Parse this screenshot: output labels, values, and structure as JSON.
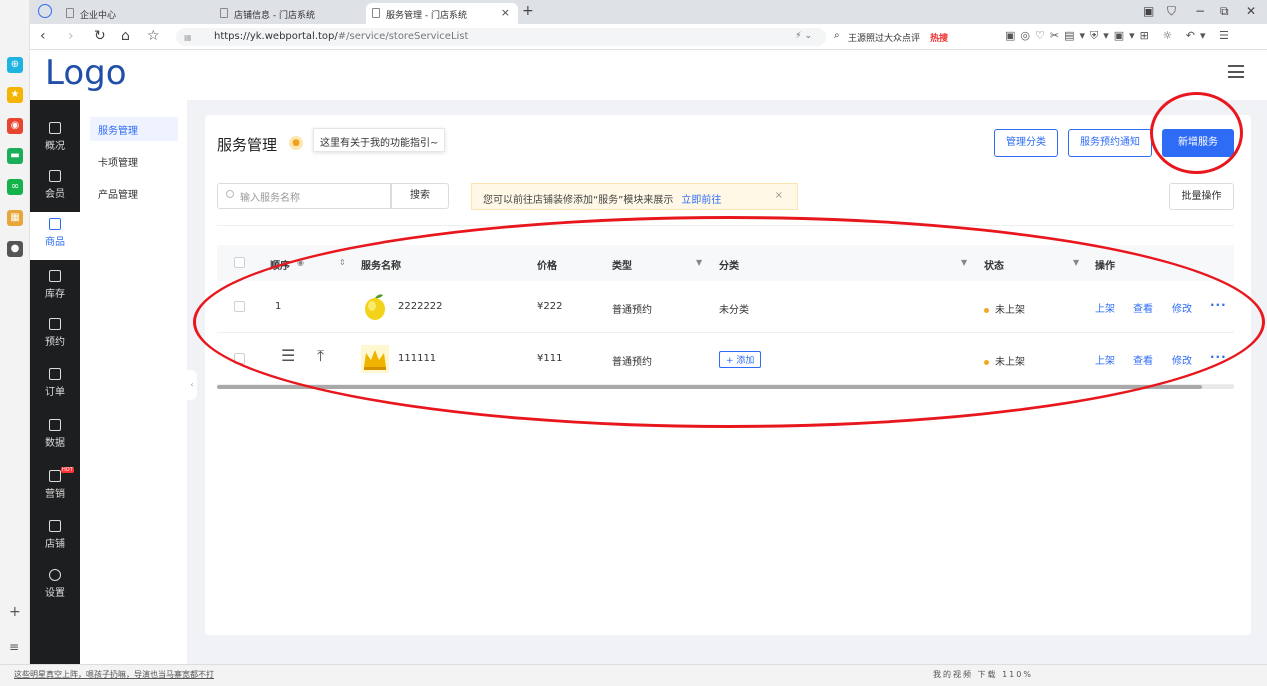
{
  "browser": {
    "tabs": [
      {
        "title": "企业中心"
      },
      {
        "title": "店铺信息 - 门店系统"
      },
      {
        "title": "服务管理 - 门店系统"
      }
    ],
    "url_host": "https://yk.webportal.top/",
    "url_path": "#/service/storeServiceList",
    "search_text": "王源照过大众点评",
    "hot_label": "热搜"
  },
  "app": {
    "logo": "Logo"
  },
  "mainnav": [
    {
      "label": "概况"
    },
    {
      "label": "会员"
    },
    {
      "label": "商品"
    },
    {
      "label": "库存"
    },
    {
      "label": "预约"
    },
    {
      "label": "订单"
    },
    {
      "label": "数据"
    },
    {
      "label": "营销"
    },
    {
      "label": "店铺"
    },
    {
      "label": "设置"
    }
  ],
  "subnav": [
    {
      "label": "服务管理"
    },
    {
      "label": "卡项管理"
    },
    {
      "label": "产品管理"
    }
  ],
  "page": {
    "title": "服务管理",
    "tip": "这里有关于我的功能指引~",
    "manage_category": "管理分类",
    "booking_notice": "服务预约通知",
    "add_service": "新增服务",
    "search_placeholder": "输入服务名称",
    "search_button": "搜索",
    "notice_text": "您可以前往店铺装修添加“服务”模块来展示",
    "notice_link": "立即前往",
    "batch_button": "批量操作"
  },
  "table": {
    "columns": {
      "order": "顺序",
      "name": "服务名称",
      "price": "价格",
      "type": "类型",
      "category": "分类",
      "status": "状态",
      "action": "操作"
    },
    "rows": [
      {
        "order": "1",
        "name": "2222222",
        "price": "¥222",
        "type": "普通预约",
        "category": "未分类",
        "status": "未上架",
        "thumb": "lemon"
      },
      {
        "order": "",
        "name": "111111",
        "price": "¥111",
        "type": "普通预约",
        "category": "+ 添加",
        "status": "未上架",
        "thumb": "crown"
      }
    ],
    "actions": {
      "publish": "上架",
      "view": "查看",
      "edit": "修改",
      "more": "···"
    }
  },
  "statusbar": {
    "marquee": "这些明星真空上阵，嗯孩子扔嘛，导演也当马寨宽都不打",
    "right_items": "我的视频  下载  110%"
  },
  "colors": {
    "primary": "#2e6cf6",
    "sidebar": "#1d1e20",
    "annotation": "#e8171e",
    "status_dot": "#f5a623"
  }
}
